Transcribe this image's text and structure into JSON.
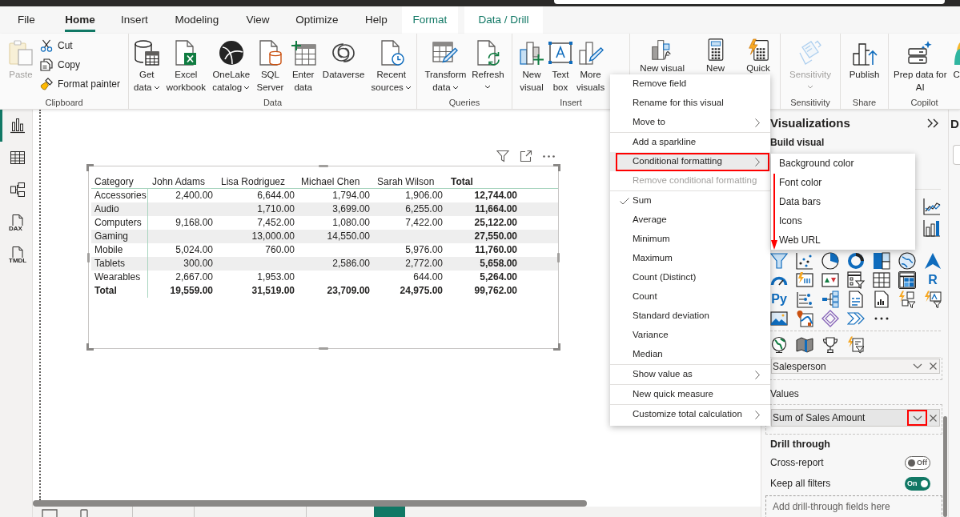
{
  "tabs": [
    {
      "label": "File",
      "kind": "standard",
      "selected": false
    },
    {
      "label": "Home",
      "kind": "standard",
      "selected": true
    },
    {
      "label": "Insert",
      "kind": "standard",
      "selected": false
    },
    {
      "label": "Modeling",
      "kind": "standard",
      "selected": false
    },
    {
      "label": "View",
      "kind": "standard",
      "selected": false
    },
    {
      "label": "Optimize",
      "kind": "standard",
      "selected": false
    },
    {
      "label": "Help",
      "kind": "standard",
      "selected": false
    },
    {
      "label": "Format",
      "kind": "contextual",
      "selected": false
    },
    {
      "label": "Data / Drill",
      "kind": "contextual",
      "selected": false
    }
  ],
  "ribbon": {
    "groups": [
      {
        "label": "Clipboard",
        "buttons": [
          {
            "kind": "paste",
            "lines": [
              "Paste"
            ],
            "dropdown": false,
            "disabled": true
          },
          {
            "kind": "cut",
            "lines": [
              "Cut"
            ],
            "dropdown": false,
            "disabled": false
          },
          {
            "kind": "copy",
            "lines": [
              "Copy"
            ],
            "dropdown": false,
            "disabled": false
          },
          {
            "kind": "format-painter",
            "lines": [
              "Format painter"
            ],
            "dropdown": false,
            "disabled": false
          }
        ]
      },
      {
        "label": "Data",
        "buttons": [
          {
            "kind": "get-data",
            "lines": [
              "Get",
              "data"
            ],
            "dropdown": true,
            "disabled": false
          },
          {
            "kind": "excel",
            "lines": [
              "Excel",
              "workbook"
            ],
            "dropdown": false,
            "disabled": false
          },
          {
            "kind": "onelake",
            "lines": [
              "OneLake",
              "catalog"
            ],
            "dropdown": true,
            "disabled": false
          },
          {
            "kind": "sql",
            "lines": [
              "SQL",
              "Server"
            ],
            "dropdown": false,
            "disabled": false
          },
          {
            "kind": "enter-data",
            "lines": [
              "Enter",
              "data"
            ],
            "dropdown": false,
            "disabled": false
          },
          {
            "kind": "dataverse",
            "lines": [
              "Dataverse"
            ],
            "dropdown": false,
            "disabled": false
          },
          {
            "kind": "recent",
            "lines": [
              "Recent",
              "sources"
            ],
            "dropdown": true,
            "disabled": false
          }
        ]
      },
      {
        "label": "Queries",
        "buttons": [
          {
            "kind": "transform",
            "lines": [
              "Transform",
              "data"
            ],
            "dropdown": true,
            "disabled": false
          },
          {
            "kind": "refresh",
            "lines": [
              "Refresh"
            ],
            "dropdown": true,
            "disabled": false
          }
        ]
      },
      {
        "label": "Insert",
        "buttons": [
          {
            "kind": "new-visual",
            "lines": [
              "New",
              "visual"
            ],
            "dropdown": false,
            "disabled": false
          },
          {
            "kind": "text-box",
            "lines": [
              "Text",
              "box"
            ],
            "dropdown": false,
            "disabled": false
          },
          {
            "kind": "more-visuals",
            "lines": [
              "More",
              "visuals"
            ],
            "dropdown": false,
            "disabled": false
          }
        ]
      },
      {
        "buttons": [
          {
            "kind": "visual-calculation",
            "lines": [
              "New visual"
            ],
            "dropdown": false,
            "disabled": false
          },
          {
            "kind": "new-measure",
            "lines": [
              "New"
            ],
            "dropdown": false,
            "disabled": false
          },
          {
            "kind": "quick-measure",
            "lines": [
              "Quick"
            ],
            "dropdown": false,
            "disabled": false
          }
        ]
      },
      {
        "label": "Sensitivity",
        "buttons": [
          {
            "kind": "sensitivity",
            "lines": [
              "Sensitivity"
            ],
            "dropdown": true,
            "disabled": true
          }
        ]
      },
      {
        "label": "Share",
        "buttons": [
          {
            "kind": "publish",
            "lines": [
              "Publish"
            ],
            "dropdown": false,
            "disabled": false
          }
        ]
      },
      {
        "label": "Copilot",
        "buttons": [
          {
            "kind": "prep-ai",
            "lines": [
              "Prep data for",
              "AI"
            ],
            "dropdown": false,
            "disabled": false
          },
          {
            "kind": "copilot",
            "lines": [
              "C"
            ],
            "dropdown": false,
            "disabled": false
          }
        ]
      }
    ]
  },
  "sidebar": [
    {
      "kind": "report",
      "selected": true
    },
    {
      "kind": "table",
      "selected": false
    },
    {
      "kind": "model",
      "selected": false
    },
    {
      "kind": "document",
      "label": "DAX",
      "selected": false
    },
    {
      "kind": "document",
      "label": "TMDL",
      "selected": false
    }
  ],
  "visual": {
    "columns": [
      "Category",
      "John Adams",
      "Lisa Rodriguez",
      "Michael Chen",
      "Sarah Wilson",
      "Total"
    ],
    "rows": [
      [
        "Accessories",
        "2,400.00",
        "6,644.00",
        "1,794.00",
        "1,906.00",
        "12,744.00"
      ],
      [
        "Audio",
        null,
        "1,710.00",
        "3,699.00",
        "6,255.00",
        "11,664.00"
      ],
      [
        "Computers",
        "9,168.00",
        "7,452.00",
        "1,080.00",
        "7,422.00",
        "25,122.00"
      ],
      [
        "Gaming",
        null,
        "13,000.00",
        "14,550.00",
        null,
        "27,550.00"
      ],
      [
        "Mobile",
        "5,024.00",
        "760.00",
        null,
        "5,976.00",
        "11,760.00"
      ],
      [
        "Tablets",
        "300.00",
        null,
        "2,586.00",
        "2,772.00",
        "5,658.00"
      ],
      [
        "Wearables",
        "2,667.00",
        "1,953.00",
        null,
        "644.00",
        "5,264.00"
      ]
    ],
    "total_row": [
      "Total",
      "19,559.00",
      "31,519.00",
      "23,709.00",
      "24,975.00",
      "99,762.00"
    ]
  },
  "context_menu": {
    "groups": [
      {
        "items": [
          {
            "label": "Remove field",
            "has_submenu": false,
            "disabled": false,
            "selected": false,
            "outlined": false
          },
          {
            "label": "Rename for this visual",
            "has_submenu": false,
            "disabled": false,
            "selected": false,
            "outlined": false
          },
          {
            "label": "Move to",
            "has_submenu": true,
            "disabled": false,
            "selected": false,
            "outlined": false
          }
        ]
      },
      {
        "items": [
          {
            "label": "Add a sparkline",
            "has_submenu": false,
            "disabled": false,
            "selected": false,
            "outlined": false
          },
          {
            "label": "Conditional formatting",
            "has_submenu": true,
            "disabled": false,
            "selected": true,
            "outlined": true
          },
          {
            "label": "Remove conditional formatting",
            "has_submenu": false,
            "disabled": true,
            "selected": false,
            "outlined": false
          }
        ]
      },
      {
        "items": [
          {
            "label": "Sum",
            "has_submenu": false,
            "disabled": false,
            "selected": false,
            "outlined": false,
            "checked": true
          },
          {
            "label": "Average",
            "has_submenu": false,
            "disabled": false,
            "selected": false,
            "outlined": false,
            "checked": false
          },
          {
            "label": "Minimum",
            "has_submenu": false,
            "disabled": false,
            "selected": false,
            "outlined": false,
            "checked": false
          },
          {
            "label": "Maximum",
            "has_submenu": false,
            "disabled": false,
            "selected": false,
            "outlined": false,
            "checked": false
          },
          {
            "label": "Count (Distinct)",
            "has_submenu": false,
            "disabled": false,
            "selected": false,
            "outlined": false,
            "checked": false
          },
          {
            "label": "Count",
            "has_submenu": false,
            "disabled": false,
            "selected": false,
            "outlined": false,
            "checked": false
          },
          {
            "label": "Standard deviation",
            "has_submenu": false,
            "disabled": false,
            "selected": false,
            "outlined": false,
            "checked": false
          },
          {
            "label": "Variance",
            "has_submenu": false,
            "disabled": false,
            "selected": false,
            "outlined": false,
            "checked": false
          },
          {
            "label": "Median",
            "has_submenu": false,
            "disabled": false,
            "selected": false,
            "outlined": false,
            "checked": false
          }
        ]
      },
      {
        "items": [
          {
            "label": "Show value as",
            "has_submenu": true,
            "disabled": false,
            "selected": false,
            "outlined": false
          }
        ]
      },
      {
        "items": [
          {
            "label": "New quick measure",
            "has_submenu": false,
            "disabled": false,
            "selected": false,
            "outlined": false
          }
        ]
      },
      {
        "items": [
          {
            "label": "Customize total calculation",
            "has_submenu": true,
            "disabled": false,
            "selected": false,
            "outlined": false
          }
        ]
      }
    ]
  },
  "submenu": {
    "items": [
      {
        "label": "Background color"
      },
      {
        "label": "Font color"
      },
      {
        "label": "Data bars"
      },
      {
        "label": "Icons"
      },
      {
        "label": "Web URL"
      }
    ],
    "annotation_arrow": true
  },
  "visualizations_pane": {
    "title": "Visualizations",
    "section": "Build visual",
    "gallery_partial": [
      {
        "kind": "line-chart",
        "selected": false
      },
      {
        "kind": "column-chart",
        "selected": false
      }
    ],
    "gallery": [
      [
        {
          "kind": "funnel",
          "selected": false
        },
        {
          "kind": "scatter",
          "selected": false
        },
        {
          "kind": "pie",
          "selected": false
        },
        {
          "kind": "donut",
          "selected": false
        },
        {
          "kind": "treemap",
          "selected": false
        },
        {
          "kind": "map",
          "selected": false
        },
        {
          "kind": "azure-map",
          "selected": false
        }
      ],
      [
        {
          "kind": "gauge",
          "selected": false
        },
        {
          "kind": "card",
          "selected": false
        },
        {
          "kind": "kpi",
          "selected": false
        },
        {
          "kind": "slicer",
          "selected": false
        },
        {
          "kind": "table",
          "selected": false
        },
        {
          "kind": "matrix",
          "selected": true
        },
        {
          "kind": "script",
          "glyph": "R",
          "selected": false
        }
      ],
      [
        {
          "kind": "script",
          "glyph": "Py",
          "selected": false
        },
        {
          "kind": "key-influencers",
          "selected": false
        },
        {
          "kind": "decomposition-tree",
          "selected": false
        },
        {
          "kind": "narrative",
          "selected": false
        },
        {
          "kind": "paginated",
          "selected": false
        },
        {
          "kind": "power-apps",
          "selected": false
        },
        {
          "kind": "power-automate",
          "selected": false
        }
      ],
      [
        {
          "kind": "image",
          "selected": false
        },
        {
          "kind": "arcgis",
          "selected": false
        },
        {
          "kind": "diamond",
          "selected": false
        },
        {
          "kind": "chevrons",
          "selected": false
        },
        {
          "kind": "more",
          "selected": false
        }
      ]
    ],
    "gallery_custom": [
      {
        "kind": "globe",
        "selected": false
      },
      {
        "kind": "filled-map",
        "selected": false
      },
      {
        "kind": "trophy",
        "selected": false
      },
      {
        "kind": "lightning-filter",
        "selected": false
      }
    ],
    "columns_well": {
      "field": "Salesperson",
      "chevron_outlined": false
    },
    "values_well": {
      "title": "Values",
      "field": "Sum of Sales Amount",
      "chevron_outlined": true
    },
    "drill_through": {
      "title": "Drill through",
      "toggles": [
        {
          "label": "Cross-report",
          "on": false,
          "text": "Off"
        },
        {
          "label": "Keep all filters",
          "on": true,
          "text": "On"
        }
      ],
      "placeholder": "Add drill-through fields here"
    }
  },
  "data_pane": {
    "title": "D"
  }
}
